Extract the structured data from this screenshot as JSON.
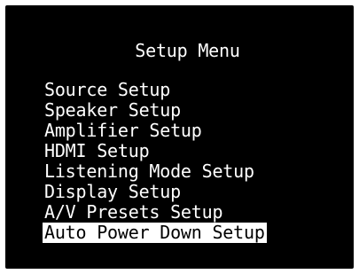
{
  "title": "Setup Menu",
  "menu": {
    "items": [
      {
        "label": "Source Setup",
        "selected": false
      },
      {
        "label": "Speaker Setup",
        "selected": false
      },
      {
        "label": "Amplifier Setup",
        "selected": false
      },
      {
        "label": "HDMI Setup",
        "selected": false
      },
      {
        "label": "Listening Mode Setup",
        "selected": false
      },
      {
        "label": "Display Setup",
        "selected": false
      },
      {
        "label": "A/V Presets Setup",
        "selected": false
      },
      {
        "label": "Auto Power Down Setup",
        "selected": true
      }
    ]
  },
  "colors": {
    "background": "#000000",
    "text": "#ffffff",
    "highlight": "#ffffff",
    "highlight_text": "#000000"
  }
}
